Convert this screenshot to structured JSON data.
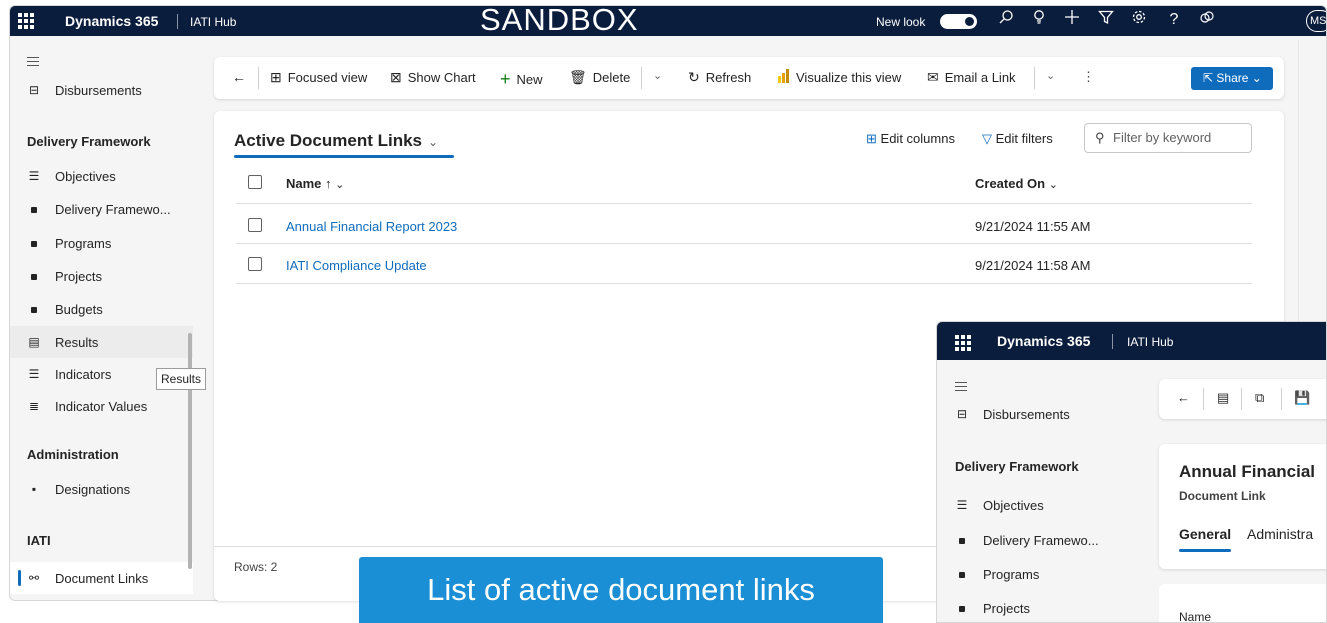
{
  "topbar": {
    "brand": "Dynamics 365",
    "app": "IATI Hub",
    "environment": "SANDBOX",
    "new_look": "New look",
    "avatar": "MS",
    "icons": [
      "search-icon",
      "lightbulb-icon",
      "plus-icon",
      "filter-icon",
      "gear-icon",
      "help-icon",
      "copilot-icon"
    ]
  },
  "sidebar": {
    "top_item": "Disbursements",
    "group1": "Delivery Framework",
    "items": [
      {
        "label": "Objectives",
        "icon": "checklist-icon"
      },
      {
        "label": "Delivery Framewo...",
        "icon": "square-icon"
      },
      {
        "label": "Programs",
        "icon": "square-icon"
      },
      {
        "label": "Projects",
        "icon": "square-icon"
      },
      {
        "label": "Budgets",
        "icon": "square-icon"
      },
      {
        "label": "Results",
        "icon": "list-icon"
      },
      {
        "label": "Indicators",
        "icon": "stack-icon"
      },
      {
        "label": "Indicator Values",
        "icon": "values-icon"
      }
    ],
    "group2": "Administration",
    "admin_item": "Designations",
    "group3": "IATI",
    "iati_item": "Document Links",
    "tooltip": "Results"
  },
  "commandbar": {
    "focused_view": "Focused view",
    "show_chart": "Show Chart",
    "new": "New",
    "delete": "Delete",
    "refresh": "Refresh",
    "visualize": "Visualize this view",
    "email_link": "Email a Link",
    "share": "Share"
  },
  "view": {
    "title": "Active Document Links",
    "edit_columns": "Edit columns",
    "edit_filters": "Edit filters",
    "filter_placeholder": "Filter by keyword",
    "columns": [
      "Name ↑",
      "Created On"
    ],
    "rows": [
      {
        "name": "Annual Financial Report 2023",
        "created_on": "9/21/2024 11:55 AM"
      },
      {
        "name": "IATI Compliance Update",
        "created_on": "9/21/2024 11:58 AM"
      }
    ],
    "row_count": "Rows: 2"
  },
  "caption": "List of active document links",
  "window2": {
    "brand": "Dynamics 365",
    "app": "IATI Hub",
    "side_top": "Disbursements",
    "side_group": "Delivery Framework",
    "side_items": [
      "Objectives",
      "Delivery Framewo...",
      "Programs",
      "Projects"
    ],
    "record_title": "Annual Financial",
    "record_type": "Document Link",
    "tab_general": "General",
    "tab_admin": "Administra",
    "field_name": "Name"
  },
  "colors": {
    "topbar": "#0b1d3d",
    "accent": "#0f6cbd",
    "caption": "#1a8fd6"
  }
}
